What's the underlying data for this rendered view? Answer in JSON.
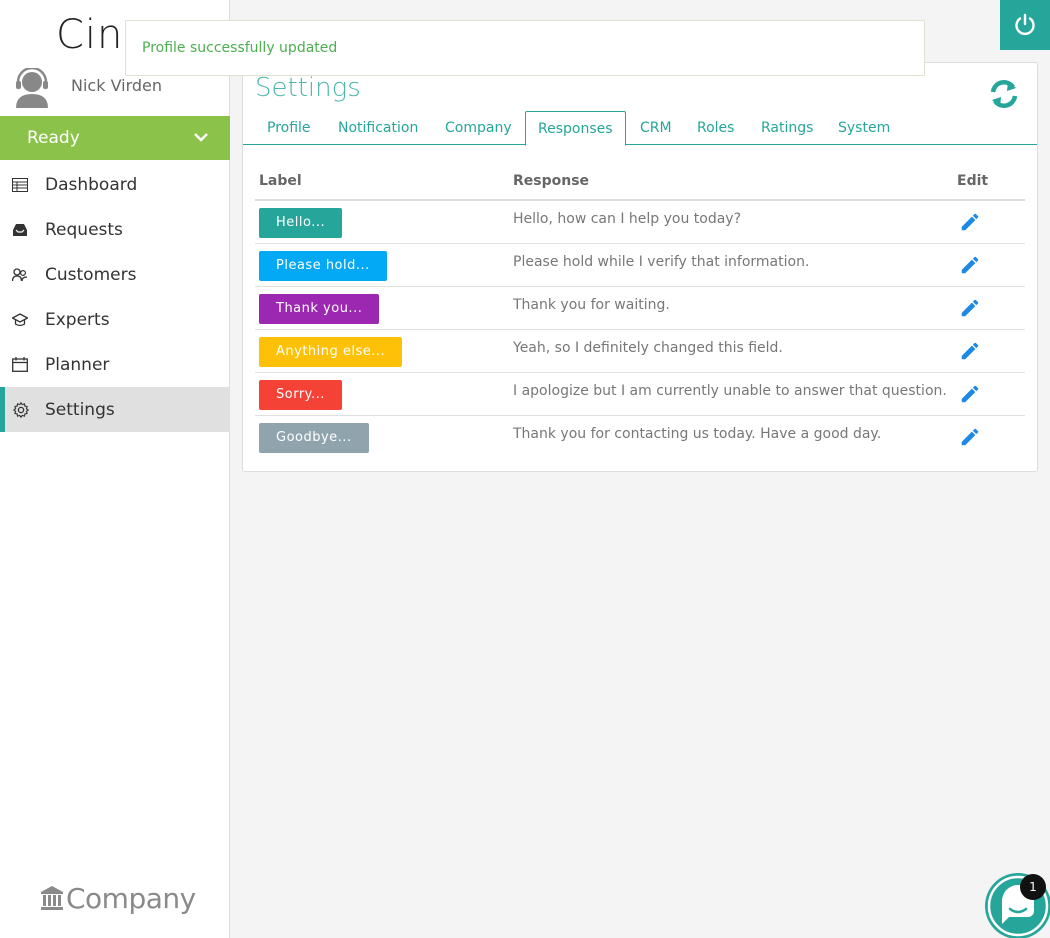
{
  "brand": {
    "logo_text": "Cinq",
    "company_logo_text": "Company"
  },
  "user": {
    "name": "Nick Virden"
  },
  "status": {
    "label": "Ready"
  },
  "nav": [
    {
      "label": "Dashboard",
      "icon": "dashboard-icon"
    },
    {
      "label": "Requests",
      "icon": "inbox-icon"
    },
    {
      "label": "Customers",
      "icon": "users-icon"
    },
    {
      "label": "Experts",
      "icon": "graduation-cap-icon"
    },
    {
      "label": "Planner",
      "icon": "calendar-icon"
    },
    {
      "label": "Settings",
      "icon": "gear-icon",
      "active": true
    }
  ],
  "toast": {
    "message": "Profile successfully updated"
  },
  "settings": {
    "title": "Settings",
    "tabs": [
      "Profile",
      "Notification",
      "Company",
      "Responses",
      "CRM",
      "Roles",
      "Ratings",
      "System"
    ],
    "active_tab": "Responses"
  },
  "responses_table": {
    "headers": {
      "label": "Label",
      "response": "Response",
      "edit": "Edit"
    },
    "rows": [
      {
        "label": "Hello...",
        "response": "Hello, how can I help you today?",
        "color": "#26a69a"
      },
      {
        "label": "Please hold...",
        "response": "Please hold while I verify that information.",
        "color": "#03a9f4"
      },
      {
        "label": "Thank you...",
        "response": "Thank you for waiting.",
        "color": "#9c27b0"
      },
      {
        "label": "Anything else...",
        "response": "Yeah, so I definitely changed this field.",
        "color": "#ffc107"
      },
      {
        "label": "Sorry...",
        "response": "I apologize but I am currently unable to answer that question.",
        "color": "#f44336"
      },
      {
        "label": "Goodbye...",
        "response": "Thank you for contacting us today. Have a good day.",
        "color": "#90a4ae"
      }
    ]
  },
  "chat": {
    "badge_count": "1"
  },
  "colors": {
    "accent": "#26a69a",
    "status_green": "#8bc34a",
    "toast_text": "#4caf50",
    "edit_icon": "#1e88e5"
  }
}
